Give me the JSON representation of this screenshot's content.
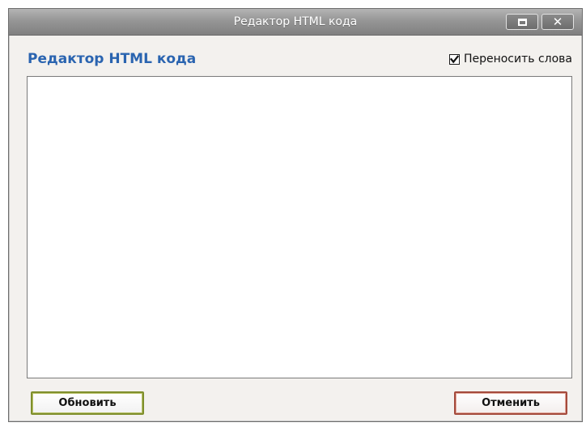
{
  "window": {
    "title": "Редактор HTML кода",
    "controls": {
      "maximize_icon": "maximize-icon",
      "close_icon": "close-icon",
      "close_glyph": "✕"
    }
  },
  "dialog": {
    "heading": "Редактор HTML кода",
    "wrap_words": {
      "label": "Переносить слова",
      "checked": true
    },
    "editor": {
      "value": "",
      "placeholder": ""
    },
    "buttons": {
      "update_label": "Обновить",
      "cancel_label": "Отменить"
    }
  },
  "colors": {
    "heading": "#2a64b0",
    "update_border": "#7f8f2c",
    "cancel_border": "#a44a3c",
    "titlebar": "#969696"
  }
}
